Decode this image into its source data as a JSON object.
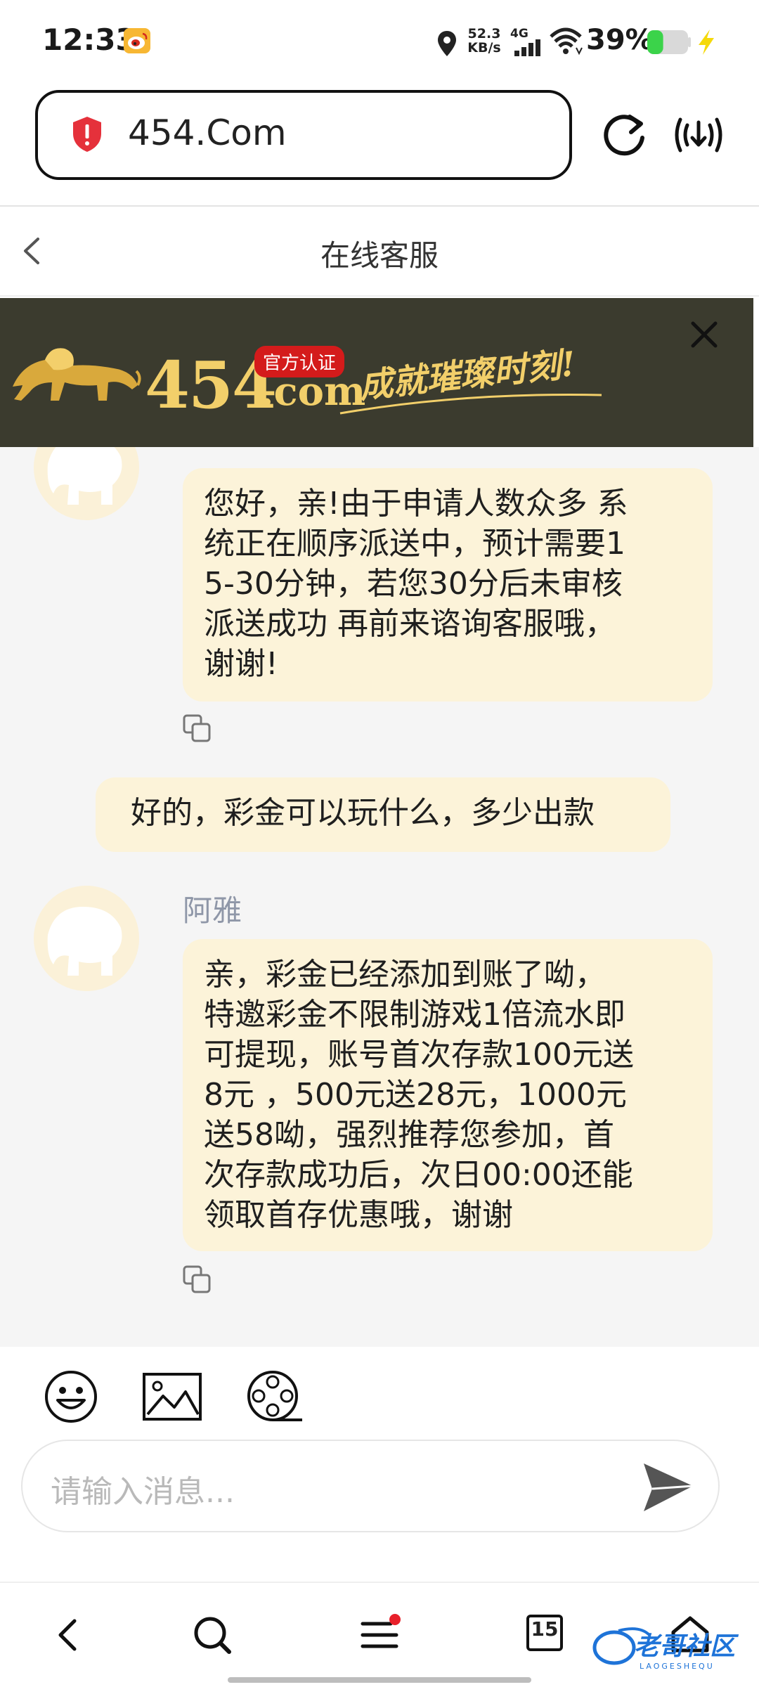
{
  "status_bar": {
    "time": "12:33",
    "net_speed_value": "52.3",
    "net_speed_unit": "KB/s",
    "network_type": "4G",
    "battery_percent": "39%",
    "battery_level": 0.39,
    "icons": [
      "weibo-icon",
      "location-icon",
      "signal-icon",
      "wifi-icon",
      "battery-icon",
      "charging-icon"
    ]
  },
  "browser": {
    "url": "454.Com",
    "icons": [
      "shield-icon",
      "reload-icon",
      "download-icon"
    ]
  },
  "chat_header": {
    "title": "在线客服",
    "back_icon": "chevron-left-icon"
  },
  "banner": {
    "brand": "454",
    "brand_suffix": ".com",
    "badge": "官方认证",
    "slogan": "成就璀璨时刻!",
    "close_icon": "close-icon",
    "colors": {
      "background": "#3b3b2e",
      "gold": "#f2cf6a",
      "badge": "#d41b1b"
    }
  },
  "messages": [
    {
      "sender": "agent",
      "name": "",
      "lines": [
        "您好，亲!由于申请人数众多 系",
        "统正在顺序派送中，预计需要1",
        "5-30分钟，若您30分后未审核",
        "派送成功 再前来谘询客服哦，",
        "谢谢!"
      ]
    },
    {
      "sender": "user",
      "lines": [
        "好的，彩金可以玩什么，多少出款"
      ]
    },
    {
      "sender": "agent",
      "name": "阿雅",
      "lines": [
        "亲，彩金已经添加到账了呦，",
        "特邀彩金不限制游戏1倍流水即",
        "可提现，账号首次存款100元送",
        "8元 ，500元送28元，1000元",
        "送58呦，强烈推荐您参加，首",
        "次存款成功后，次日00:00还能",
        "领取首存优惠哦，谢谢"
      ]
    }
  ],
  "composer": {
    "placeholder": "请输入消息...",
    "tools": [
      "emoji-icon",
      "image-icon",
      "video-icon"
    ],
    "send_icon": "send-icon"
  },
  "bottom_nav": {
    "tabs_count": "15",
    "items": [
      "back-icon",
      "search-icon",
      "menu-icon",
      "tabs-icon",
      "home-icon"
    ],
    "menu_has_notification": true,
    "watermark": "老哥社区",
    "watermark_sub": "LAOGESHEQU"
  },
  "colors": {
    "bubble": "#fcf3d9",
    "chat_background": "#f5f5f5",
    "agent_name": "#8f97a8",
    "battery_fill": "#3bd34a",
    "notification_dot": "#e8202a"
  }
}
